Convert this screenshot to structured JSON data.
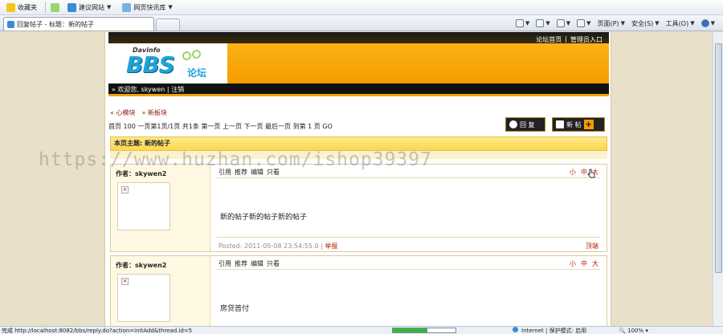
{
  "ie": {
    "favorites": "收藏夹",
    "suggested_sites": "建议网站",
    "web_slice": "网页快讯库",
    "tab_title": "回复帖子 - 标题：新的帖子",
    "tools": {
      "page": "页面(P)",
      "safety": "安全(S)",
      "tools": "工具(O)"
    }
  },
  "site": {
    "header_links": [
      "论坛首页",
      "管理员入口"
    ],
    "logo_small": "Davinfo",
    "logo_big": "BBS",
    "logo_cn": "论坛",
    "welcome": "» 欢迎您, skywen | 注销",
    "breadcrumbs": [
      "心模块",
      "新板块"
    ],
    "pager": "首页 100 一页第1页/1页 共1条 第一页 上一页 下一页 最后一页 到第 1 页 GO",
    "reply_button": "回 复",
    "new_post_button": "新 帖",
    "topic_label": "本页主题: 新的帖子"
  },
  "posts": [
    {
      "author": "作者：skywen2",
      "ops": [
        "引用",
        "推荐",
        "编辑",
        "只看"
      ],
      "sizes": [
        "小",
        "中",
        "大"
      ],
      "content": "新的帖子新的帖子新的帖子",
      "meta_posted": "Posted: 2011-05-08 23:54:55.0",
      "meta_report": "举报",
      "to_top": "顶端"
    },
    {
      "author": "作者：skywen2",
      "ops": [
        "引用",
        "推荐",
        "编辑",
        "只看"
      ],
      "sizes": [
        "小",
        "中",
        "大"
      ],
      "content": "房贷首付"
    }
  ],
  "watermark": "https://www.huzhan.com/ishop39397",
  "status": {
    "url": "完成 http://localhost:8082/bbs/reply.do?action=initAdd&thread.id=5",
    "zone": "Internet | 保护模式: 启用",
    "zoom": "100%",
    "progress": 0.55
  }
}
